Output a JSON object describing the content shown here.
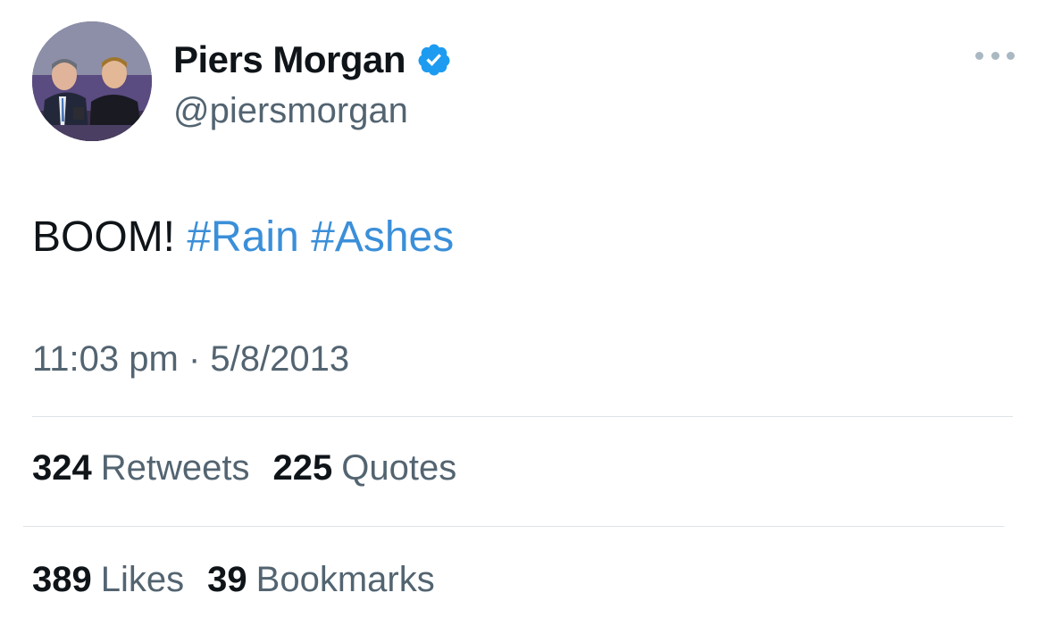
{
  "user": {
    "display_name": "Piers Morgan",
    "handle": "@piersmorgan",
    "verified": true
  },
  "tweet": {
    "text_plain": "BOOM!",
    "hashtags": [
      "#Rain",
      "#Ashes"
    ],
    "time": "11:03 pm",
    "separator": "·",
    "date": "5/8/2013"
  },
  "stats": {
    "retweets": {
      "count": "324",
      "label": "Retweets"
    },
    "quotes": {
      "count": "225",
      "label": "Quotes"
    },
    "likes": {
      "count": "389",
      "label": "Likes"
    },
    "bookmarks": {
      "count": "39",
      "label": "Bookmarks"
    }
  },
  "icons": {
    "verified": "verified-badge-icon",
    "more": "more-options-icon"
  },
  "colors": {
    "text": "#0f1419",
    "secondary": "#536471",
    "hashtag": "#3b8fd9",
    "verified": "#1d9bf0",
    "divider": "#dde3e8"
  }
}
